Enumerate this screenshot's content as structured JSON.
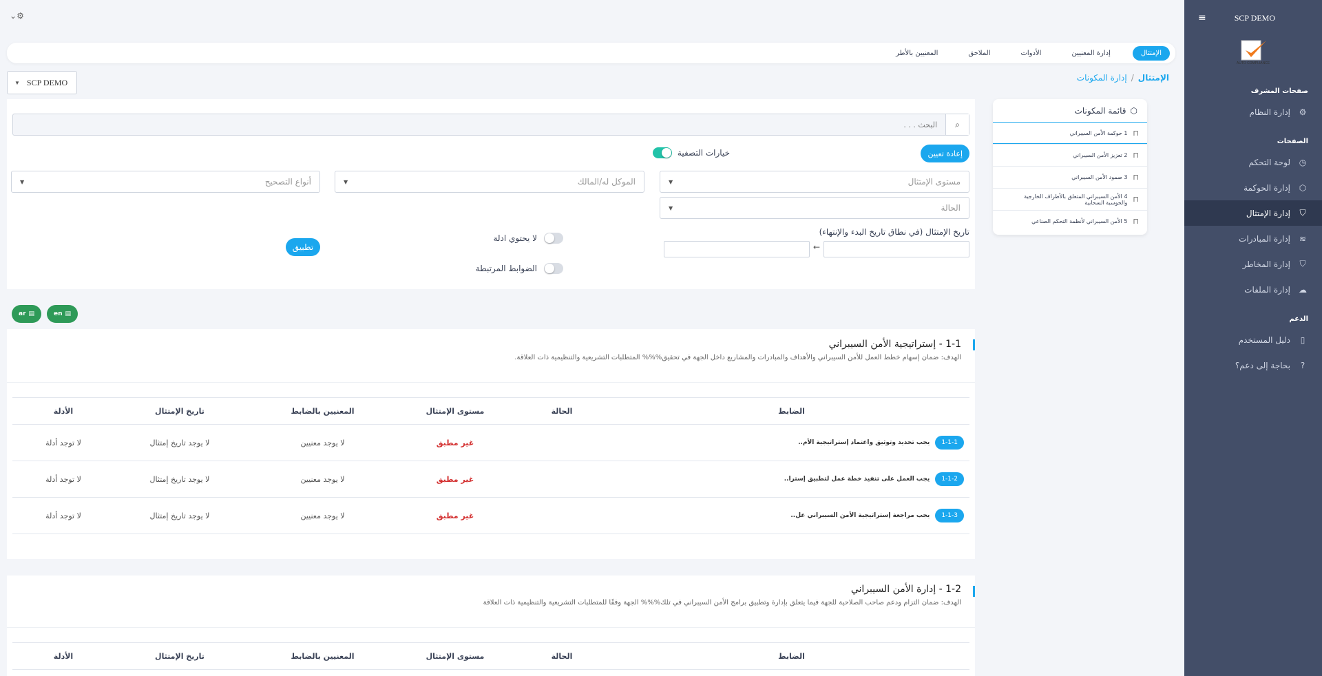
{
  "sidebar": {
    "brand": "SCP DEMO",
    "logo_text": "AUTO COMPLIANCE",
    "sections": [
      {
        "title": "صفحات المشرف",
        "items": [
          {
            "label": "إدارة النظام",
            "icon": "gear-icon",
            "glyph": "⚙"
          }
        ]
      },
      {
        "title": "الصفحات",
        "items": [
          {
            "label": "لوحة التحكم",
            "icon": "dashboard-icon",
            "glyph": "◷"
          },
          {
            "label": "إدارة الحوكمة",
            "icon": "cube-icon",
            "glyph": "⬡"
          },
          {
            "label": "إدارة الإمتثال",
            "icon": "shield-check-icon",
            "glyph": "⛉"
          },
          {
            "label": "إدارة المبادرات",
            "icon": "layers-icon",
            "glyph": "≋"
          },
          {
            "label": "إدارة المخاطر",
            "icon": "shield-icon",
            "glyph": "⛉"
          },
          {
            "label": "إدارة الملفات",
            "icon": "cloud-upload-icon",
            "glyph": "☁"
          }
        ]
      },
      {
        "title": "الدعم",
        "items": [
          {
            "label": "دليل المستخدم",
            "icon": "book-icon",
            "glyph": "▯"
          },
          {
            "label": "بحاجة إلى دعم؟",
            "icon": "help-icon",
            "glyph": "?"
          }
        ]
      }
    ]
  },
  "top_tabs": [
    "الإمتثال",
    "إدارة المعنيين",
    "الأدوات",
    "الملاحق",
    "المعنيين بالأطر"
  ],
  "breadcrumb": [
    "الإمتثال",
    "/",
    "إدارة المكونات"
  ],
  "org_select": "SCP DEMO",
  "components": {
    "title": "قائمة المكونات",
    "items": [
      "1 حوكمة الأمن السيبراني",
      "2 تعزيز الأمن السيبراني",
      "3 صمود الأمن السيبراني",
      "4 الأمن السيبراني المتعلق بالأطراف الخارجية والحوسبة السحابية",
      "5 الأمن السيبراني لأنظمة التحكم الصناعي"
    ]
  },
  "filters": {
    "search_placeholder": "البحث . . .",
    "reset_label": "إعادة تعيين",
    "filter_options_label": "خيارات التصفية",
    "compliance_level": "مستوى الإمتثال",
    "owner": "الموكل له/المالك",
    "correction_types": "أنواع التصحيح",
    "status": "الحالة",
    "date_label": "تاريخ الإمتثال (في نطاق تاريخ البدء والإنتهاء)",
    "no_evidence": "لا يحتوي ادلة",
    "linked_controls": "الضوابط المرتبطة",
    "apply_label": "تطبيق"
  },
  "export": {
    "en": "en",
    "ar": "ar"
  },
  "table_headers": {
    "control": "الضابط",
    "status": "الحالة",
    "level": "مستوى الإمتثال",
    "assignees": "المعنيين بالضابط",
    "date": "تاريخ الإمتثال",
    "evidence": "الأدلة"
  },
  "sections": [
    {
      "title": "1-1 - إستراتيجية الأمن السيبراني",
      "goal": "الهدف: ضمان إسهام خطط العمل للأمن السيبراني والأهداف والمبادرات والمشاريع داخل الجهة في تحقيق%%% المتطلبات التشريعية والتنظيمية ذات العلاقة.",
      "rows": [
        {
          "code": "1-1-1",
          "text": "يجب تحديد وتوثيق واعتماد إستراتيجية الأم..",
          "status": "",
          "level": "غير مطبق",
          "assignees": "لا يوجد معنيين",
          "date": "لا يوجد تاريخ إمتثال",
          "evidence": "لا توجد أدلة"
        },
        {
          "code": "1-1-2",
          "text": "يجب العمل على تنفيذ خطة عمل لتطبيق إسترا..",
          "status": "",
          "level": "غير مطبق",
          "assignees": "لا يوجد معنيين",
          "date": "لا يوجد تاريخ إمتثال",
          "evidence": "لا توجد أدلة"
        },
        {
          "code": "1-1-3",
          "text": "يجب مراجعة إستراتيجية الأمن السيبراني عل..",
          "status": "",
          "level": "غير مطبق",
          "assignees": "لا يوجد معنيين",
          "date": "لا يوجد تاريخ إمتثال",
          "evidence": "لا توجد أدلة"
        }
      ]
    },
    {
      "title": "1-2 - إدارة الأمن السيبراني",
      "goal": "الهدف: ضمان التزام ودعم صاحب الصلاحية للجهة فيما يتعلق بإدارة وتطبيق برامج الأمن السيبراني في تلك%%% الجهة وفقًا للمتطلبات التشريعية والتنظيمية ذات العلاقة",
      "rows": []
    }
  ]
}
